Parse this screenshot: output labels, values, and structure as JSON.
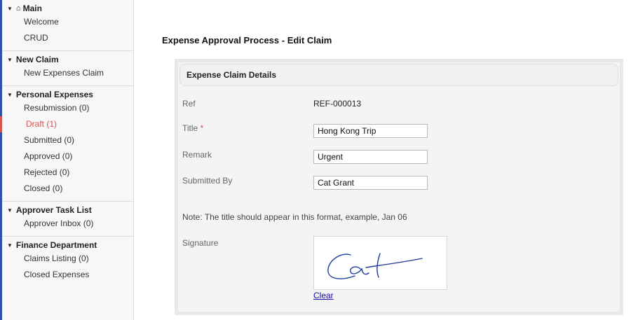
{
  "sidebar": {
    "sections": [
      {
        "title": "Main",
        "items": [
          "Welcome",
          "CRUD"
        ]
      },
      {
        "title": "New Claim",
        "items": [
          "New Expenses Claim"
        ]
      },
      {
        "title": "Personal Expenses",
        "items": [
          "Resubmission (0)",
          "Draft (1)",
          "Submitted (0)",
          "Approved (0)",
          "Rejected (0)",
          "Closed (0)"
        ]
      },
      {
        "title": "Approver Task List",
        "items": [
          "Approver Inbox (0)"
        ]
      },
      {
        "title": "Finance Department",
        "items": [
          "Claims Listing (0)",
          "Closed Expenses"
        ]
      }
    ],
    "active_item": "Draft (1)",
    "accent_color": "#2f4fa8",
    "active_color": "#d9534f"
  },
  "page": {
    "title": "Expense Approval Process - Edit Claim"
  },
  "form": {
    "header": "Expense Claim Details",
    "ref_label": "Ref",
    "ref_value": "REF-000013",
    "title_label": "Title",
    "title_required_mark": "*",
    "title_value": "Hong Kong Trip",
    "remark_label": "Remark",
    "remark_value": "Urgent",
    "submitted_by_label": "Submitted By",
    "submitted_by_value": "Cat Grant",
    "note": "Note: The title should appear in this format, example, Jan 06",
    "signature_label": "Signature",
    "clear_link": "Clear"
  }
}
